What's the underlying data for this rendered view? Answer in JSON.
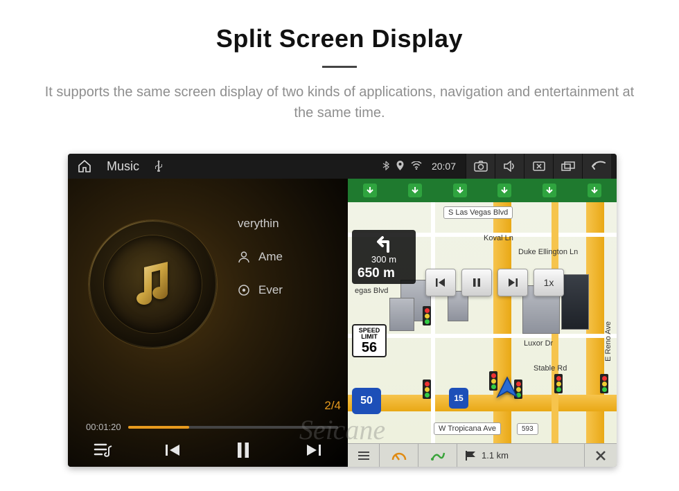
{
  "header": {
    "title": "Split Screen Display",
    "subtitle": "It supports the same screen display of two kinds of applications, navigation and entertainment at the same time."
  },
  "statusbar": {
    "title": "Music",
    "clock": "20:07"
  },
  "music": {
    "track1": "verythin",
    "track2": "Ame",
    "track3": "Ever",
    "counter": "2/4",
    "elapsed": "00:01:20"
  },
  "nav": {
    "turn_small": "300 m",
    "turn_big": "650 m",
    "speed_label": "SPEED LIMIT",
    "speed_value": "56",
    "route_no": "50",
    "interstate": "15",
    "playback_speed": "1x",
    "labels": {
      "vegas_blvd": "S Las Vegas Blvd",
      "koval": "Koval Ln",
      "duke": "Duke Ellington Ln",
      "egas": "egas Blvd",
      "luxor": "Luxor Dr",
      "stable": "Stable Rd",
      "reno": "E Reno Ave",
      "tropicana": "W Tropicana Ave",
      "trop_no": "593"
    },
    "bottom": {
      "dist": "1.1 km"
    }
  },
  "watermark": "Seicane"
}
